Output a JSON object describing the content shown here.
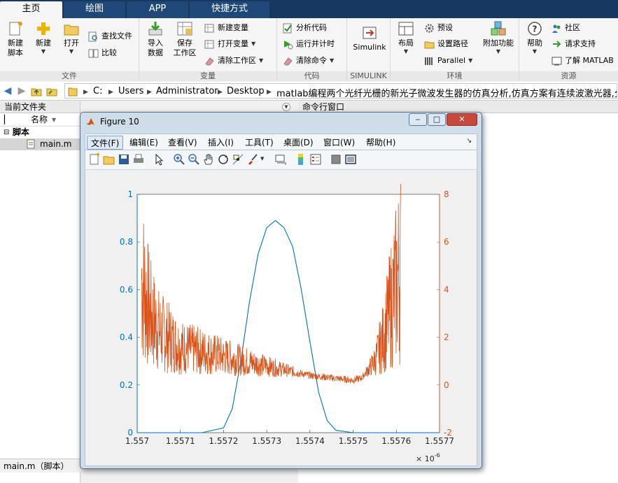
{
  "tabs": [
    "主页",
    "绘图",
    "APP",
    "快捷方式"
  ],
  "ribbon": {
    "groups": [
      "文件",
      "变量",
      "代码",
      "SIMULINK",
      "环境",
      "资源"
    ],
    "file": {
      "new_script": [
        "新建",
        "脚本"
      ],
      "new": "新建",
      "open": "打开",
      "find_files": "查找文件",
      "compare": "比较"
    },
    "variable": {
      "import": [
        "导入",
        "数据"
      ],
      "save": [
        "保存",
        "工作区"
      ],
      "new_variable": "新建变量",
      "open_variable": "打开变量",
      "clear_workspace": "清除工作区"
    },
    "code": {
      "analyze": "分析代码",
      "run_time": "运行并计时",
      "clear_cmd": "清除命令"
    },
    "simulink": "Simulink",
    "env": {
      "layout": "布局",
      "prefs": "预设",
      "set_path": "设置路径",
      "parallel": "Parallel",
      "addons": "附加功能"
    },
    "resources": {
      "help": "帮助",
      "community": "社区",
      "support": "请求支持",
      "learn": "了解 MATLAB"
    }
  },
  "address": {
    "crumbs": [
      "C:",
      "Users",
      "Administrator",
      "Desktop",
      "matlab编程两个光纤光栅的新光子微波发生器的仿真分析,仿真方案有连续波激光器,分光器,两"
    ]
  },
  "left_panel": {
    "title": "当前文件夹",
    "col_name": "名称",
    "group": "脚本",
    "file": "main.m",
    "status": "main.m（脚本）"
  },
  "right_panel": {
    "title": "命令行窗口"
  },
  "figure": {
    "title": "Figure 10",
    "menus": [
      "文件(F)",
      "编辑(E)",
      "查看(V)",
      "插入(I)",
      "工具(T)",
      "桌面(D)",
      "窗口(W)",
      "帮助(H)"
    ],
    "x_ticks": [
      "1.557",
      "1.5571",
      "1.5572",
      "1.5573",
      "1.5574",
      "1.5575",
      "1.5576",
      "1.5577"
    ],
    "x_exponent": "× 10",
    "x_exp_power": "-6",
    "y_left_ticks": [
      "0",
      "0.2",
      "0.4",
      "0.6",
      "0.8",
      "1"
    ],
    "y_right_ticks": [
      "-2",
      "0",
      "2",
      "4",
      "6",
      "8"
    ]
  },
  "chart_data": {
    "type": "line",
    "title": "",
    "xlabel": "",
    "ylabel": "",
    "x_scale": 1e-06,
    "xlim": [
      1.557,
      1.5577
    ],
    "ylim_left": [
      0,
      1
    ],
    "ylim_right": [
      -2,
      8
    ],
    "grid": false,
    "series": [
      {
        "axis": "left",
        "color": "#0072bd",
        "x": [
          1.557,
          1.55715,
          1.5572,
          1.55722,
          1.55724,
          1.55726,
          1.55728,
          1.5573,
          1.55732,
          1.55734,
          1.55736,
          1.55738,
          1.5574,
          1.55742,
          1.55744,
          1.55746,
          1.5575,
          1.5577
        ],
        "y": [
          0,
          0,
          0.02,
          0.1,
          0.3,
          0.55,
          0.75,
          0.86,
          0.89,
          0.86,
          0.78,
          0.6,
          0.38,
          0.17,
          0.05,
          0.01,
          0,
          0
        ]
      },
      {
        "axis": "right",
        "color": "#d95319",
        "x": [
          1.55701,
          1.55703,
          1.55705,
          1.5571,
          1.5572,
          1.5573,
          1.5574,
          1.5575,
          1.55752,
          1.55755,
          1.55757,
          1.55759,
          1.55761
        ],
        "y": [
          4.5,
          3.0,
          2.3,
          1.6,
          1.2,
          0.8,
          0.4,
          0.2,
          0.3,
          1.0,
          2.0,
          3.5,
          5.0
        ]
      }
    ]
  }
}
